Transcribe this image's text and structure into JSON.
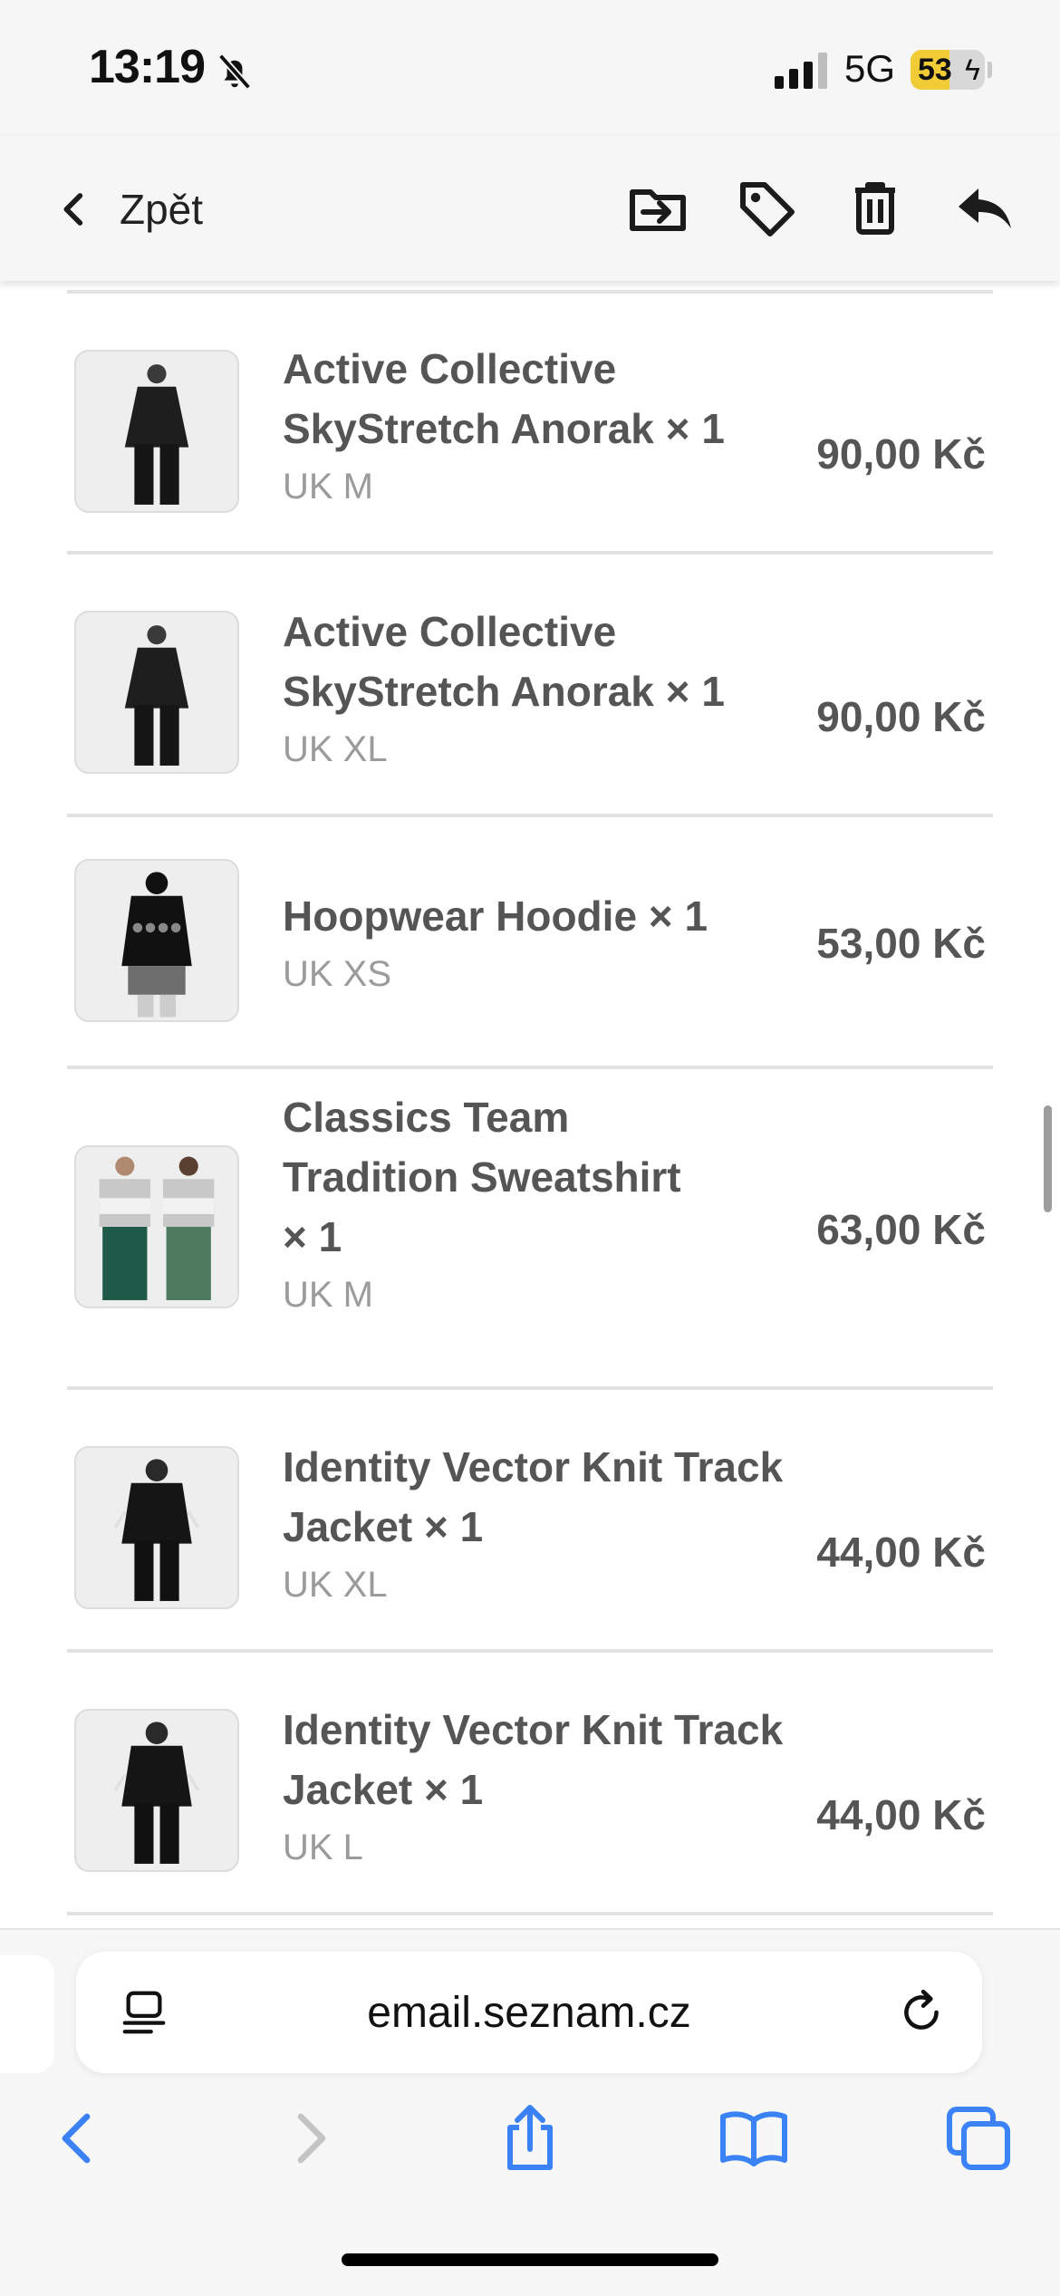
{
  "status_bar": {
    "time": "13:19",
    "network": "5G",
    "battery": "53",
    "battery_level": 0.53,
    "icons": [
      "bell-slash-icon",
      "signal-icon",
      "battery-icon",
      "bolt-icon"
    ]
  },
  "toolbar": {
    "back_label": "Zpět",
    "icons": [
      "chevron-left-icon",
      "move-to-folder-icon",
      "tag-icon",
      "trash-icon",
      "reply-icon"
    ]
  },
  "items": [
    {
      "title": "Active Collective SkyStretch Anorak × 1",
      "size": "UK M",
      "price": "90,00 Kč"
    },
    {
      "title": "Active Collective SkyStretch Anorak × 1",
      "size": "UK XL",
      "price": "90,00 Kč"
    },
    {
      "title": "Hoopwear Hoodie × 1",
      "size": "UK XS",
      "price": "53,00 Kč"
    },
    {
      "title": "Classics Team Tradition Sweatshirt × 1",
      "size": "UK M",
      "price": "63,00 Kč"
    },
    {
      "title": "Identity Vector Knit Track Jacket × 1",
      "size": "UK XL",
      "price": "44,00 Kč"
    },
    {
      "title": "Identity Vector Knit Track Jacket × 1",
      "size": "UK L",
      "price": "44,00 Kč"
    }
  ],
  "browser": {
    "url": "email.seznam.cz",
    "icons": [
      "page-menu-icon",
      "reload-icon",
      "back-arrow-icon",
      "forward-arrow-icon",
      "share-icon",
      "bookmarks-icon",
      "tabs-icon"
    ]
  },
  "colors": {
    "bar_background": "#f6f6f6",
    "accent_blue": "#3b82f6",
    "battery_yellow": "#f2cc37",
    "text_gray": "#555555",
    "size_gray": "#9b9b9b"
  }
}
